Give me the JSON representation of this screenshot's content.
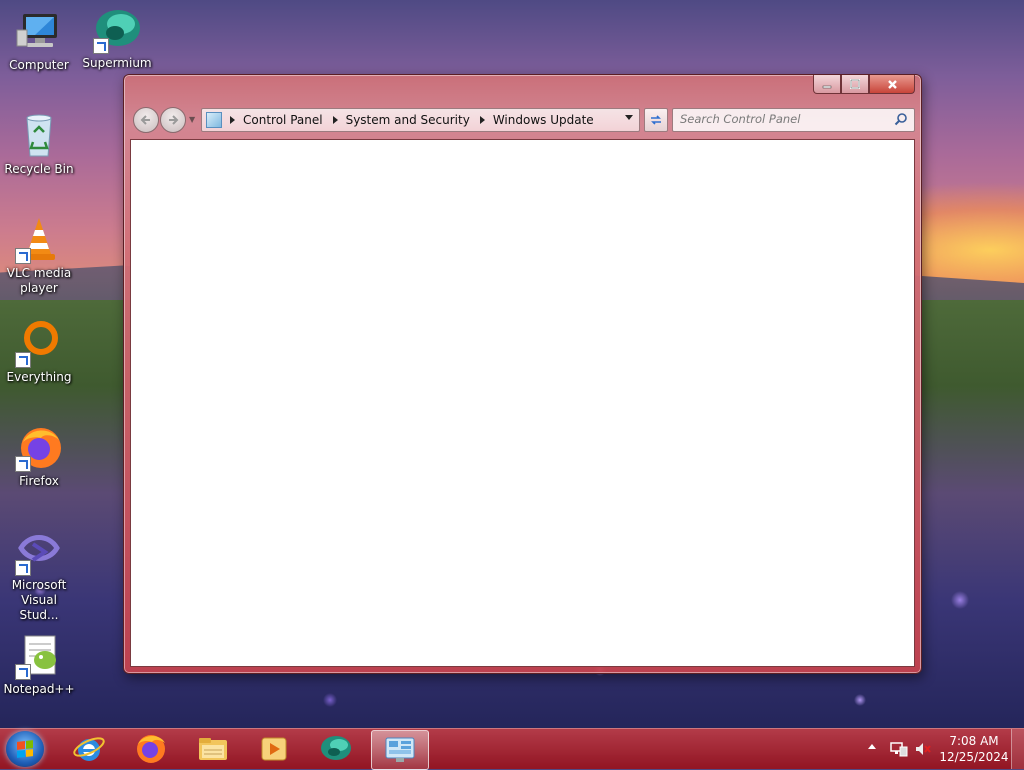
{
  "desktop": {
    "icons": [
      {
        "label": "Computer"
      },
      {
        "label": "Supermium"
      },
      {
        "label": "Recycle Bin"
      },
      {
        "label": "VLC media player"
      },
      {
        "label": "Everything"
      },
      {
        "label": "Firefox"
      },
      {
        "label": "Microsoft Visual Stud..."
      },
      {
        "label": "Notepad++"
      }
    ]
  },
  "window": {
    "breadcrumb": [
      "Control Panel",
      "System and Security",
      "Windows Update"
    ],
    "search_placeholder": "Search Control Panel",
    "accent_color": "#c8453a"
  },
  "taskbar": {
    "items": [
      "start-button",
      "internet-explorer-icon",
      "firefox-icon",
      "file-explorer-icon",
      "media-player-icon",
      "supermium-icon",
      "control-panel-icon"
    ],
    "active_item": "control-panel-icon",
    "clock": {
      "time": "7:08 AM",
      "date": "12/25/2024"
    }
  }
}
